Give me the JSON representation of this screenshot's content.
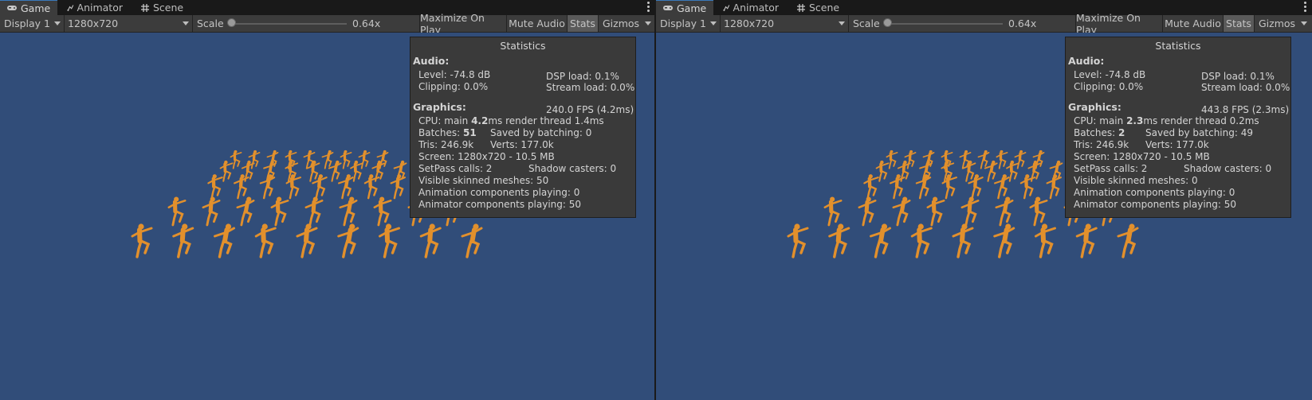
{
  "colors": {
    "game_background": "#314d79",
    "figure": "#e2902c",
    "panel": "#3c3c3c",
    "stats_bg": "#3a3a3a"
  },
  "panels": [
    {
      "tabs": [
        {
          "label": "Game",
          "icon": "gamepad-icon"
        },
        {
          "label": "Animator",
          "icon": "animator-icon"
        },
        {
          "label": "Scene",
          "icon": "scene-grid-icon"
        }
      ],
      "toolbar": {
        "display": "Display 1",
        "resolution": "1280x720",
        "scale_label": "Scale",
        "scale_value": "0.64x",
        "maximize": "Maximize On Play",
        "mute": "Mute Audio",
        "stats": "Stats",
        "gizmos": "Gizmos"
      },
      "stats": {
        "title": "Statistics",
        "audio_label": "Audio:",
        "level": "Level: -74.8 dB",
        "dsp": "DSP load: 0.1%",
        "clipping": "Clipping: 0.0%",
        "stream": "Stream load: 0.0%",
        "graphics_label": "Graphics:",
        "fps": "240.0 FPS (4.2ms)",
        "cpu_pre": "CPU: main ",
        "cpu_main": "4.2",
        "cpu_post": "ms  render thread 1.4ms",
        "batches_pre": "Batches: ",
        "batches_val": "51",
        "saved": "Saved by batching: 0",
        "tris": "Tris: 246.9k",
        "verts": "Verts: 177.0k",
        "screen": "Screen: 1280x720 - 10.5 MB",
        "setpass": "SetPass calls: 2",
        "shadow": "Shadow casters: 0",
        "skinned": "Visible skinned meshes: 50",
        "anim": "Animation components playing: 0",
        "animator": "Animator components playing: 50"
      }
    },
    {
      "tabs": [
        {
          "label": "Game",
          "icon": "gamepad-icon"
        },
        {
          "label": "Animator",
          "icon": "animator-icon"
        },
        {
          "label": "Scene",
          "icon": "scene-grid-icon"
        }
      ],
      "toolbar": {
        "display": "Display 1",
        "resolution": "1280x720",
        "scale_label": "Scale",
        "scale_value": "0.64x",
        "maximize": "Maximize On Play",
        "mute": "Mute Audio",
        "stats": "Stats",
        "gizmos": "Gizmos"
      },
      "stats": {
        "title": "Statistics",
        "audio_label": "Audio:",
        "level": "Level: -74.8 dB",
        "dsp": "DSP load: 0.1%",
        "clipping": "Clipping: 0.0%",
        "stream": "Stream load: 0.0%",
        "graphics_label": "Graphics:",
        "fps": "443.8 FPS (2.3ms)",
        "cpu_pre": "CPU: main ",
        "cpu_main": "2.3",
        "cpu_post": "ms  render thread 0.2ms",
        "batches_pre": "Batches: ",
        "batches_val": "2",
        "saved": "Saved by batching: 49",
        "tris": "Tris: 246.9k",
        "verts": "Verts: 177.0k",
        "screen": "Screen: 1280x720 - 10.5 MB",
        "setpass": "SetPass calls: 2",
        "shadow": "Shadow casters: 0",
        "skinned": "Visible skinned meshes: 0",
        "anim": "Animation components playing: 0",
        "animator": "Animator components playing: 50"
      }
    }
  ]
}
